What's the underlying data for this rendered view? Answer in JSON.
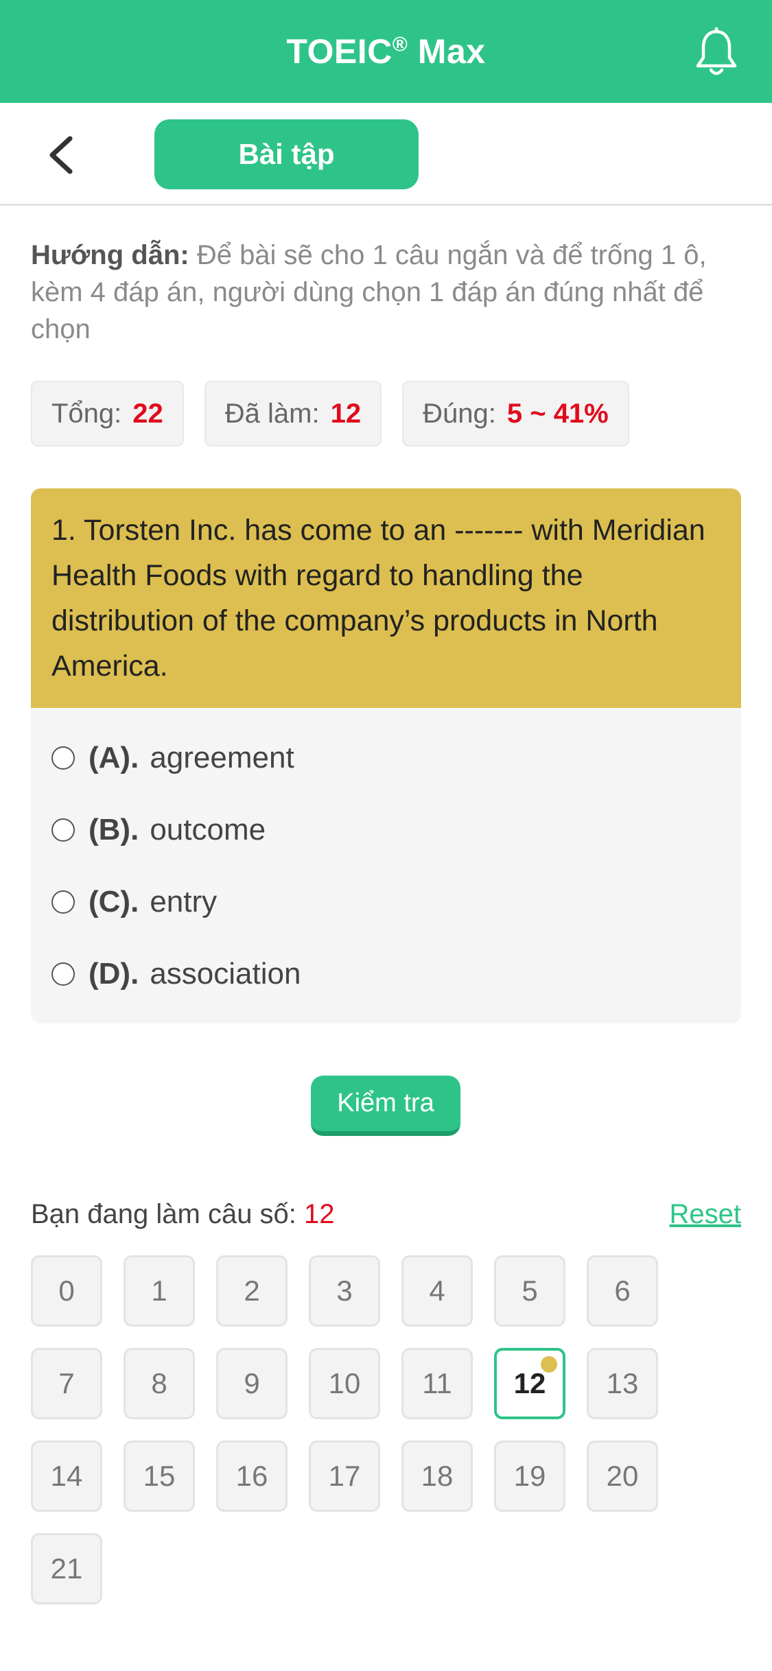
{
  "header": {
    "title": "TOEIC",
    "reg": "®",
    "title_suffix": " Max"
  },
  "subbar": {
    "tab_label": "Bài tập"
  },
  "guide": {
    "label": "Hướng dẫn:",
    "text": " Để bài sẽ cho 1 câu ngắn và để trống 1 ô, kèm 4 đáp án, người dùng chọn 1 đáp án đúng nhất để chọn"
  },
  "stats": {
    "total_label": "Tổng:",
    "total_value": "22",
    "done_label": "Đã làm:",
    "done_value": "12",
    "correct_label": "Đúng:",
    "correct_value": "5 ~ 41%"
  },
  "question": {
    "text": "1. Torsten Inc. has come to an ------- with Meridian Health Foods with regard to handling the distribution of the company’s products in North America.",
    "options": [
      {
        "label": "(A).",
        "text": "agreement"
      },
      {
        "label": "(B).",
        "text": "outcome"
      },
      {
        "label": "(C).",
        "text": "entry"
      },
      {
        "label": "(D).",
        "text": "association"
      }
    ]
  },
  "check_button": "Kiểm tra",
  "progress": {
    "current_label": "Bạn đang làm câu số:",
    "current_value": "12",
    "reset_label": "Reset",
    "numbers": [
      "0",
      "1",
      "2",
      "3",
      "4",
      "5",
      "6",
      "7",
      "8",
      "9",
      "10",
      "11",
      "12",
      "13",
      "14",
      "15",
      "16",
      "17",
      "18",
      "19",
      "20",
      "21"
    ],
    "active": "12"
  },
  "colors": {
    "brand": "#2ec489",
    "question_bg": "#dcbf50",
    "highlight": "#e00b1c"
  },
  "icons": {
    "bell": "bell-icon",
    "back": "chevron-left-icon"
  }
}
